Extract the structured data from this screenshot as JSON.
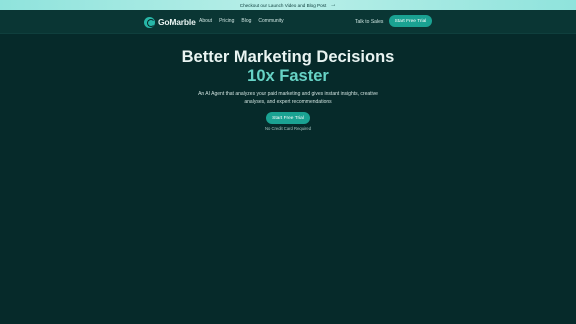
{
  "announcement": {
    "text": "Checkout our Launch Video and Blog Post",
    "arrow_icon": "arrow-right-icon"
  },
  "header": {
    "logo_text": "GoMarble",
    "nav": [
      "About",
      "Pricing",
      "Blog",
      "Community"
    ],
    "talk_to_sales": "Talk to Sales",
    "cta_label": "Start Free Trial"
  },
  "hero": {
    "title_line1": "Better Marketing Decisions",
    "title_line2": "10x Faster",
    "subtitle": "An AI Agent that analyzes your paid marketing and gives instant insights, creative analyses, and expert recommendations",
    "cta_label": "Start Free Trial",
    "note": "No Credit Card Required"
  },
  "colors": {
    "background": "#062a2a",
    "accent": "#1aa292",
    "accent_text": "#67d3c6",
    "announcement_bg": "#b9efe8"
  }
}
